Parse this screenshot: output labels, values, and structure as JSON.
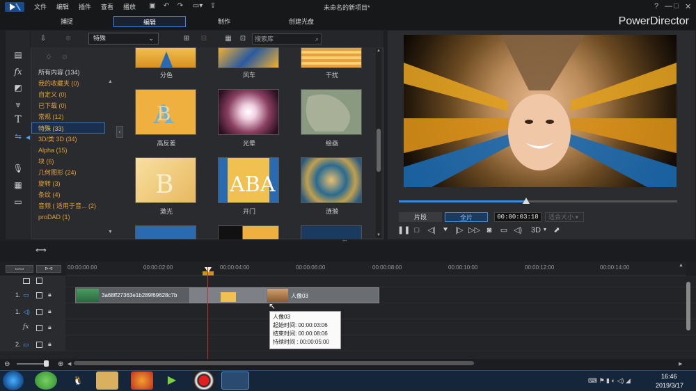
{
  "menu": [
    "文件",
    "编辑",
    "插件",
    "查看",
    "播放"
  ],
  "project_title": "未命名的新项目*",
  "window_buttons": {
    "help": "?",
    "minimize": "—",
    "maximize": "□",
    "close": "✕"
  },
  "modes": [
    "捕捉",
    "编辑",
    "制作",
    "创建光盘"
  ],
  "active_mode": "编辑",
  "brand": "PowerDirector",
  "library": {
    "category_dropdown": "特殊",
    "search_placeholder": "搜索库",
    "categories": [
      {
        "label": "所有内容 (134)"
      },
      {
        "label": "我的收藏夹 (0)"
      },
      {
        "label": "自定义 (0)"
      },
      {
        "label": "已下载 (0)"
      },
      {
        "label": "常规 (12)"
      },
      {
        "label": "特殊 (33)"
      },
      {
        "label": "3D/类 3D (34)"
      },
      {
        "label": "Alpha (15)"
      },
      {
        "label": "块 (6)"
      },
      {
        "label": "几何图形 (24)"
      },
      {
        "label": "旋转 (3)"
      },
      {
        "label": "条纹 (4)"
      },
      {
        "label": "音频 ( 适用于音... (2)"
      },
      {
        "label": "proDAD (1)"
      }
    ],
    "selected_category": "特殊 (33)",
    "thumbnails": [
      {
        "label": "分色"
      },
      {
        "label": "风车"
      },
      {
        "label": "干扰"
      },
      {
        "label": "高反差"
      },
      {
        "label": "光晕"
      },
      {
        "label": "绘画"
      },
      {
        "label": "激光"
      },
      {
        "label": "开门"
      },
      {
        "label": "涟漪"
      }
    ]
  },
  "preview": {
    "clip_button": "片段",
    "movie_button": "全片",
    "timecode": "00:00:03:18",
    "zoom": "适合大小",
    "mode_3d": "3D",
    "progress": 0.46
  },
  "timeline": {
    "ruler_labels": [
      "00:00:00:00",
      "00:00:02:00",
      "00:00:04:00",
      "00:00:06:00",
      "00:00:08:00",
      "00:00:10:00",
      "00:00:12:00",
      "00:00:14:00"
    ],
    "track_labels": [
      "1.",
      "1.",
      "fx",
      "2."
    ],
    "clips": [
      {
        "label": "3a68ff27363e1b289f69628c7b"
      },
      {
        "label": ""
      },
      {
        "label": "人像03"
      }
    ],
    "tooltip": {
      "title": "人像03",
      "start": "起始时间: 00:00:03:06",
      "end": "结束时间: 00:00:08:06",
      "duration": "持续时间 : 00:00:05:00"
    }
  },
  "taskbar": {
    "time": "16:46",
    "date": "2019/3/17"
  }
}
